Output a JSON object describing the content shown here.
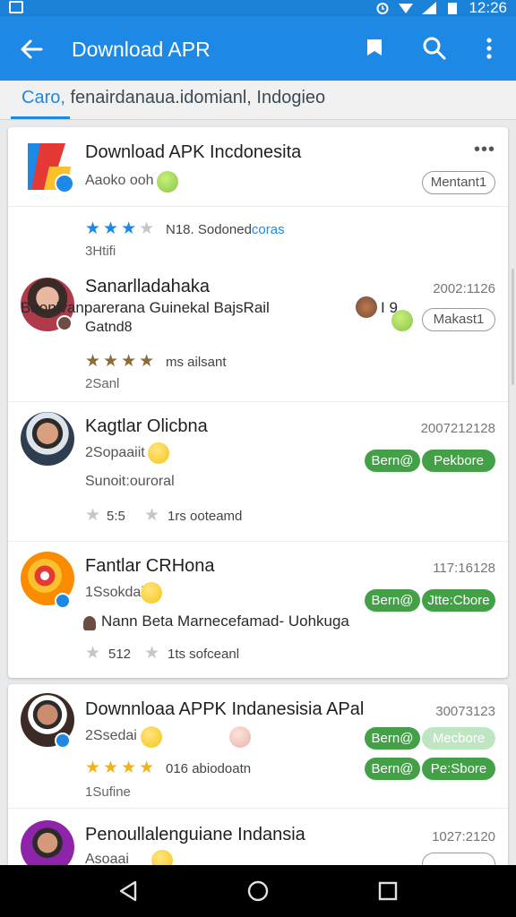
{
  "status_bar": {
    "time": "12:26"
  },
  "app_bar": {
    "title": "Download APR",
    "back_icon": "arrow-left-icon",
    "actions": [
      "bookmark-icon",
      "search-icon",
      "more-vert-icon"
    ]
  },
  "search": {
    "query_prefix": "Caro, ",
    "query_rest": "fenairdanaua.idomianl, Indogieo"
  },
  "items": [
    {
      "name": "Download APK Incdonesita",
      "sub": "Aaoko ooh",
      "menu": "•••",
      "button": "Mentant1",
      "rating_text": "N18. Sodoned",
      "rating_link": "coras",
      "meta": "3Htifi"
    },
    {
      "name": "Sanarlladahaka",
      "line2": "Baonlvanparerana Guinekal BajsRail",
      "line2_suffix": "I 9",
      "line3": "Gatnd8",
      "time": "2002:1126",
      "button": "Makast1",
      "rating_text": "ms ailsant",
      "meta": "2Sanl"
    },
    {
      "name": "Kagtlar Olicbna",
      "sub": "2Sopaaiit",
      "extra": "Sunoit:ouroral",
      "time": "2007212128",
      "button_a": "Bern@",
      "button_b": "Pekbore",
      "rating_num": "5:5",
      "rating_text": "1rs ooteamd"
    },
    {
      "name": "Fantlar CRHona",
      "sub": "1Ssokdai",
      "extra": "Nann Beta Marnecefamad- Uohkuga",
      "time": "117:16128",
      "button_a": "Bern@",
      "button_b": "Jtte:Cbore",
      "rating_num": "512",
      "rating_text": "1ts sofceanl"
    },
    {
      "name": "Downnloaa APPK Indanesisia APal",
      "sub": "2Ssedai",
      "time": "30073123",
      "button_a": "Bern@",
      "button_b": "Mecbore",
      "button_c": "Bern@",
      "button_d": "Pe:Sbore",
      "rating_text": "016 abiodoatn",
      "meta": "1Sufine"
    },
    {
      "name": "Penoullalenguiane Indansia",
      "sub": "Asoaai",
      "time": "1027:2120"
    }
  ],
  "nav_bar": [
    "back-triangle-icon",
    "home-circle-icon",
    "recents-square-icon"
  ],
  "colors": {
    "primary": "#1e88e5",
    "green": "#43a047"
  }
}
